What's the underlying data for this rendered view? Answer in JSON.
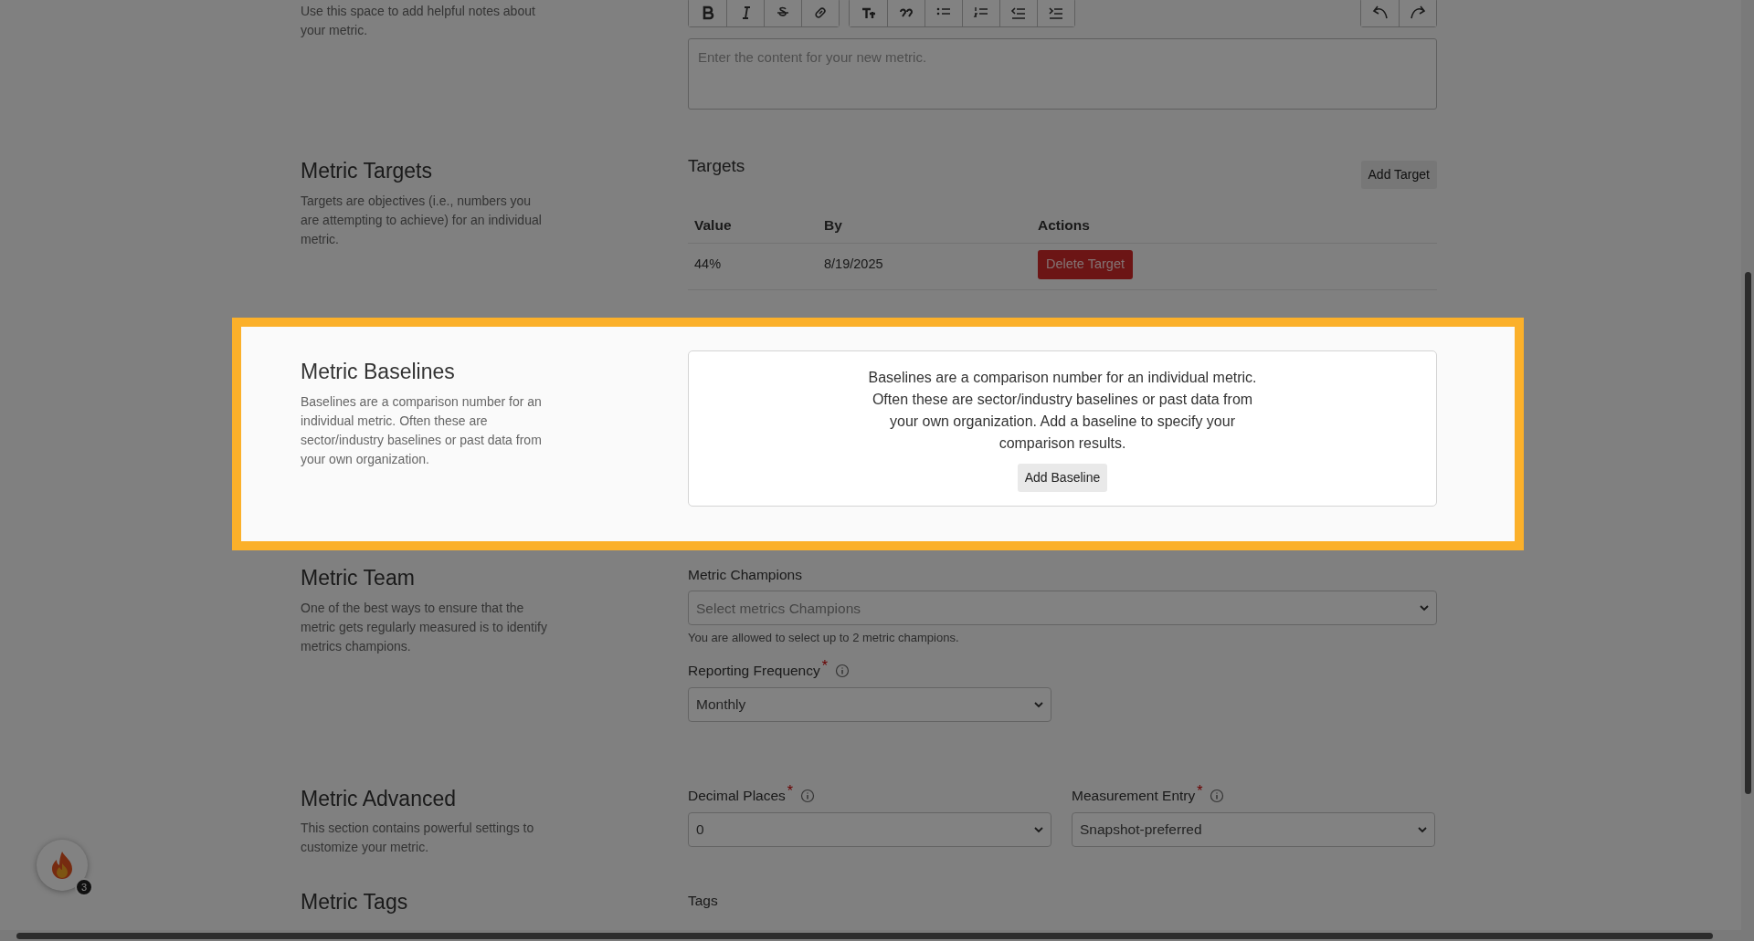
{
  "sections": [
    {
      "kind": "notes",
      "highlighted": false,
      "description": "Use this space to add helpful notes about your metric.",
      "editor": {
        "placeholder": "Enter the content for your new metric."
      }
    },
    {
      "kind": "targets",
      "highlighted": false,
      "title": "Metric Targets",
      "description": "Targets are objectives (i.e., numbers you are attempting to achieve) for an individual metric.",
      "panel_title": "Targets",
      "add_button": "Add Target",
      "table": {
        "columns": [
          "Value",
          "By",
          "Actions"
        ],
        "rows": [
          {
            "value": "44%",
            "by": "8/19/2025",
            "action": "Delete Target"
          }
        ]
      }
    },
    {
      "kind": "baselines",
      "highlighted": true,
      "title": "Metric Baselines",
      "description": "Baselines are a comparison number for an individual metric. Often these are sector/industry baselines or past data from your own organization.",
      "empty_message": "Baselines are a comparison number for an individual metric. Often these are sector/industry baselines or past data from your own organization. Add a baseline to specify your comparison results.",
      "add_button": "Add Baseline"
    },
    {
      "kind": "fields",
      "highlighted": false,
      "title": "Metric Team",
      "description": "One of the best ways to ensure that the metric gets regularly measured is to identify metrics champions.",
      "rows": [
        [
          {
            "label": "Metric Champions",
            "placeholder": "Select metrics Champions",
            "hint": "You are allowed to select up to 2 metric champions.",
            "info": false
          }
        ],
        [
          {
            "label": "Reporting Frequency",
            "required_mark": "*",
            "value": "Monthly",
            "info": true
          }
        ]
      ]
    },
    {
      "kind": "fields",
      "highlighted": false,
      "title": "Metric Advanced",
      "description": "This section contains powerful settings to customize your metric.",
      "rows": [
        [
          {
            "label": "Decimal Places",
            "required_mark": "*",
            "value": "0",
            "info": true
          },
          {
            "label": "Measurement Entry",
            "required_mark": "*",
            "value": "Snapshot-preferred",
            "info": true
          }
        ]
      ]
    },
    {
      "kind": "tags",
      "highlighted": false,
      "title": "Metric Tags",
      "field_label": "Tags"
    }
  ],
  "notification_badge": {
    "count": "3"
  }
}
